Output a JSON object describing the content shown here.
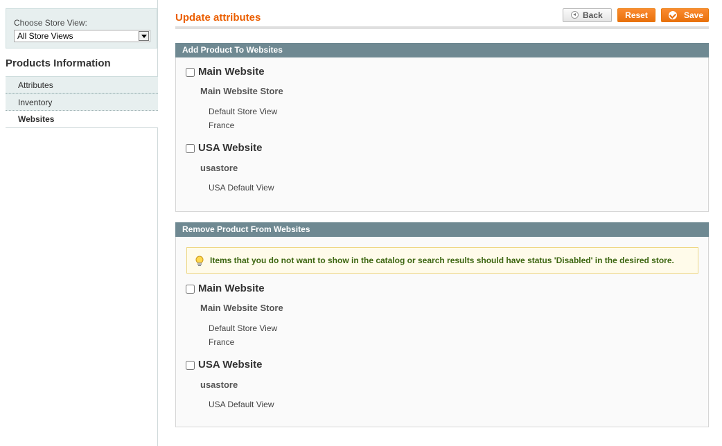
{
  "sidebar": {
    "store_label": "Choose Store View:",
    "store_value": "All Store Views",
    "title": "Products Information",
    "tabs": [
      "Attributes",
      "Inventory",
      "Websites"
    ],
    "active_tab": "Websites"
  },
  "header": {
    "title": "Update attributes",
    "back_label": "Back",
    "reset_label": "Reset",
    "save_label": "Save"
  },
  "add_section": {
    "title": "Add Product To Websites",
    "websites": [
      {
        "name": "Main Website",
        "store": "Main Website Store",
        "views": [
          "Default Store View",
          "France"
        ]
      },
      {
        "name": "USA Website",
        "store": "usastore",
        "views": [
          "USA Default View"
        ]
      }
    ]
  },
  "remove_section": {
    "title": "Remove Product From Websites",
    "notice": "Items that you do not want to show in the catalog or search results should have status 'Disabled' in the desired store.",
    "websites": [
      {
        "name": "Main Website",
        "store": "Main Website Store",
        "views": [
          "Default Store View",
          "France"
        ]
      },
      {
        "name": "USA Website",
        "store": "usastore",
        "views": [
          "USA Default View"
        ]
      }
    ]
  },
  "colors": {
    "accent": "#eb5e00",
    "section_header": "#6f8992",
    "notice_text": "#3d6611"
  }
}
